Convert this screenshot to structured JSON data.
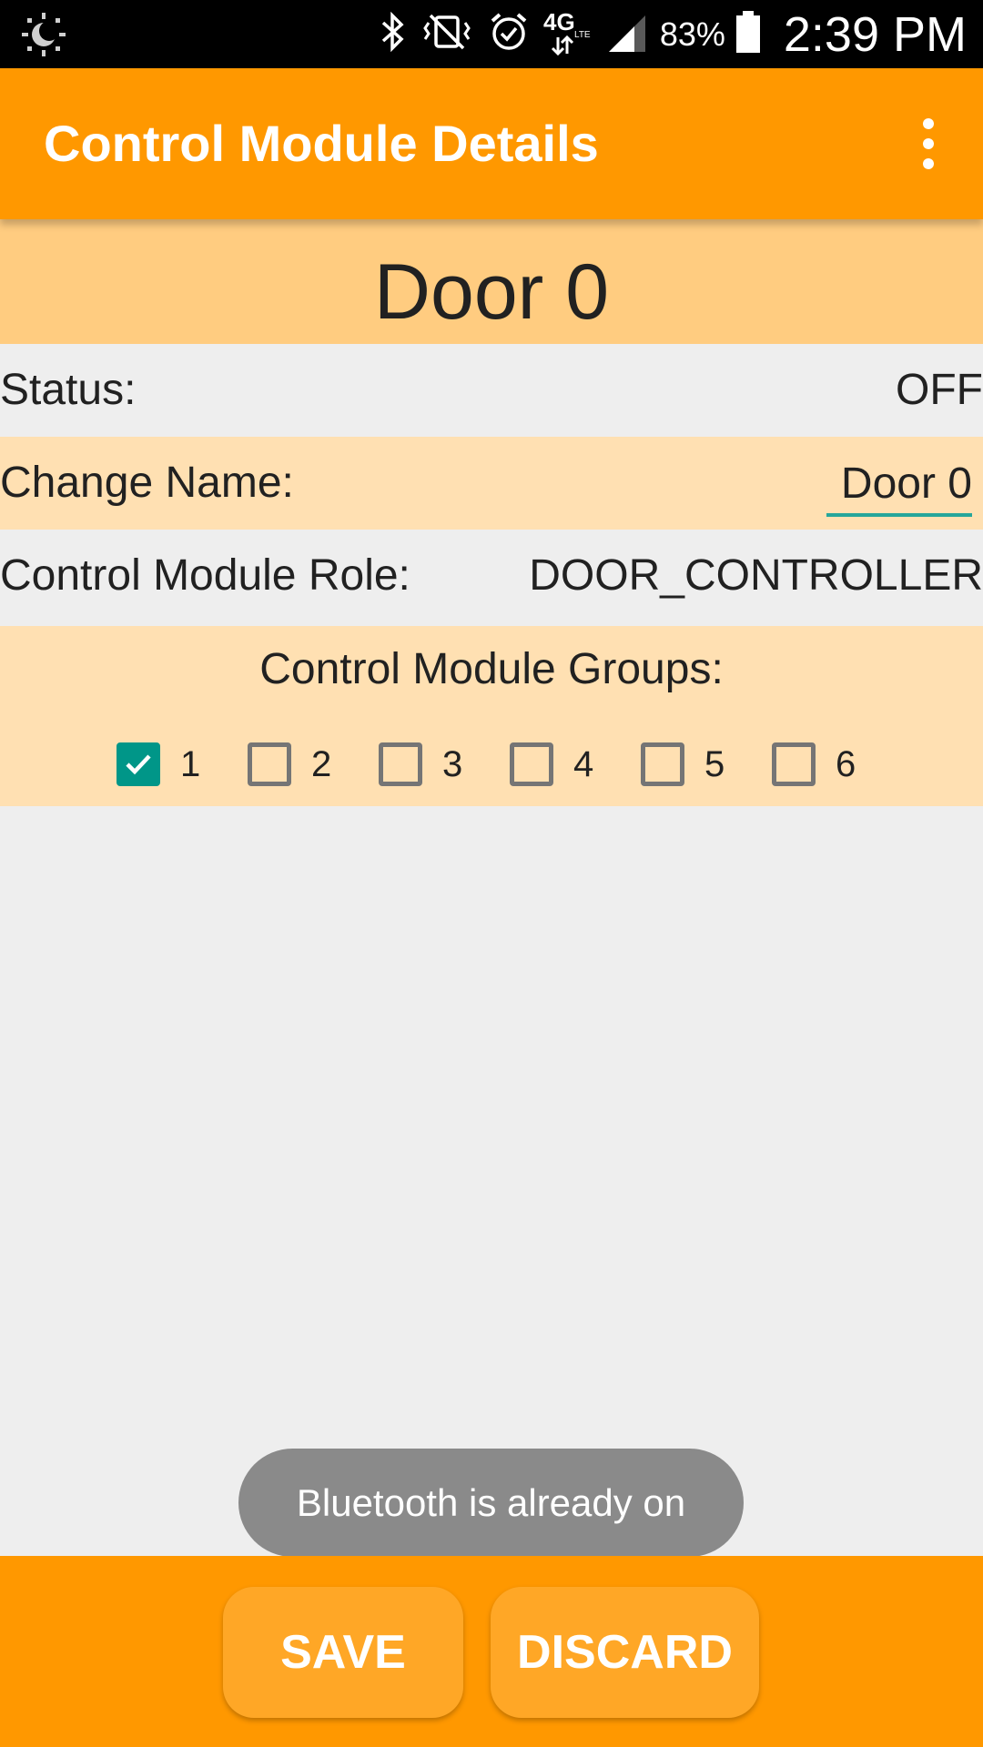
{
  "status_bar": {
    "battery_percent": "83%",
    "time": "2:39 PM",
    "network": "4G LTE",
    "icons": [
      "brightness-icon",
      "bluetooth-icon",
      "vibrate-icon",
      "alarm-icon",
      "network-4g-icon",
      "signal-icon",
      "battery-icon"
    ]
  },
  "app_bar": {
    "title": "Control Module Details",
    "overflow_icon": "more-vert-icon"
  },
  "door": {
    "title": "Door 0"
  },
  "status_row": {
    "label": "Status:",
    "value": "OFF"
  },
  "name_row": {
    "label": "Change Name:",
    "value": "Door 0"
  },
  "role_row": {
    "label": "Control Module Role:",
    "value": "DOOR_CONTROLLER"
  },
  "groups": {
    "title": "Control Module Groups:",
    "items": [
      {
        "label": "1",
        "checked": true
      },
      {
        "label": "2",
        "checked": false
      },
      {
        "label": "3",
        "checked": false
      },
      {
        "label": "4",
        "checked": false
      },
      {
        "label": "5",
        "checked": false
      },
      {
        "label": "6",
        "checked": false
      }
    ]
  },
  "toast": {
    "message": "Bluetooth is already on"
  },
  "actions": {
    "save_label": "SAVE",
    "discard_label": "DISCARD"
  },
  "colors": {
    "primary": "#ff9800",
    "title_row": "#ffcc80",
    "light_row": "#ffe0b2",
    "accent": "#009688",
    "toast": "#8a8a8a"
  }
}
